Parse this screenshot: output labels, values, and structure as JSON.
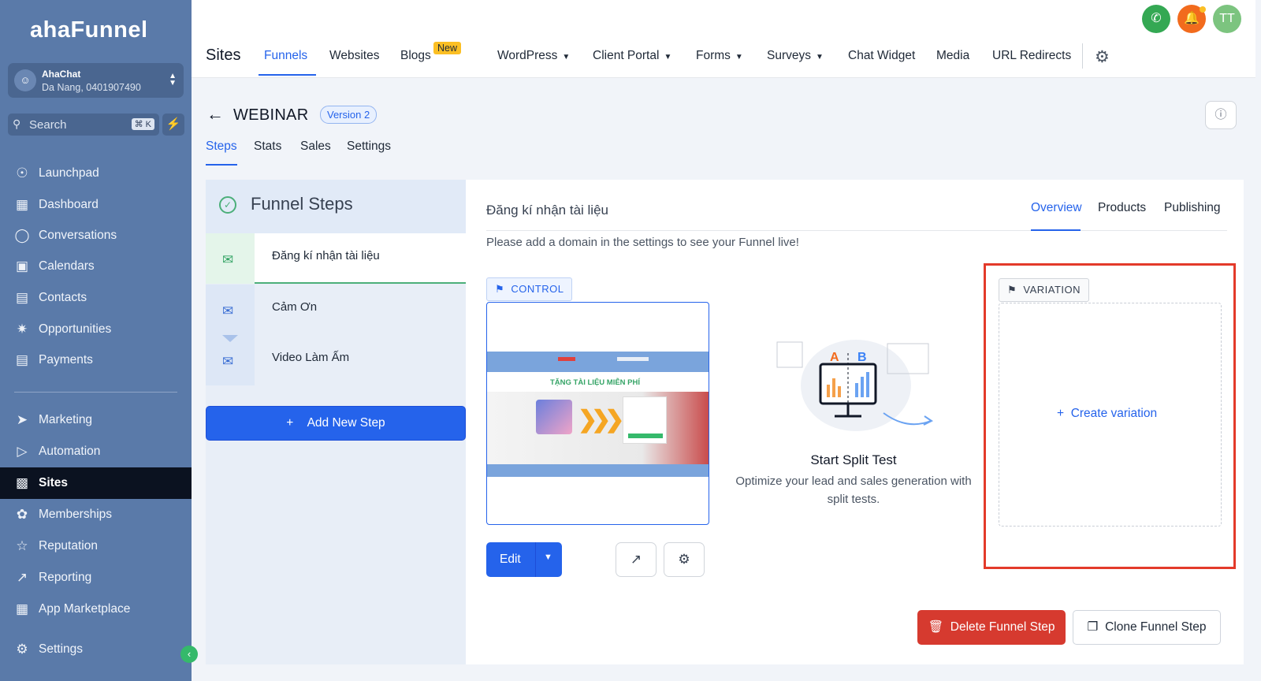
{
  "brand": {
    "logo_text": "ahaFunnel"
  },
  "account": {
    "name": "AhaChat",
    "sub": "Da Nang, 0401907490",
    "avatar_icon": "user-icon"
  },
  "search": {
    "placeholder": "Search",
    "shortcut": "⌘ K"
  },
  "sidebar": {
    "items": [
      {
        "label": "Launchpad",
        "icon": "launchpad-icon"
      },
      {
        "label": "Dashboard",
        "icon": "dashboard-icon"
      },
      {
        "label": "Conversations",
        "icon": "chat-icon"
      },
      {
        "label": "Calendars",
        "icon": "calendar-icon"
      },
      {
        "label": "Contacts",
        "icon": "contacts-icon"
      },
      {
        "label": "Opportunities",
        "icon": "opportunities-icon"
      },
      {
        "label": "Payments",
        "icon": "payments-icon"
      },
      {
        "label": "Marketing",
        "icon": "send-icon"
      },
      {
        "label": "Automation",
        "icon": "automation-icon"
      },
      {
        "label": "Sites",
        "icon": "sites-icon",
        "active": true
      },
      {
        "label": "Memberships",
        "icon": "award-icon"
      },
      {
        "label": "Reputation",
        "icon": "star-icon"
      },
      {
        "label": "Reporting",
        "icon": "trend-icon"
      },
      {
        "label": "App Marketplace",
        "icon": "grid-icon"
      },
      {
        "label": "Settings",
        "icon": "gear-icon"
      }
    ]
  },
  "topbar": {
    "title": "Sites",
    "tabs": [
      "Funnels",
      "Websites",
      "Blogs",
      "WordPress",
      "Client Portal",
      "Forms",
      "Surveys",
      "Chat Widget",
      "Media",
      "URL Redirects"
    ],
    "active_tab": "Funnels",
    "new_badge": "New",
    "avatar_initials": "TT"
  },
  "funnel": {
    "name": "WEBINAR",
    "version": "Version 2",
    "subtabs": [
      "Steps",
      "Stats",
      "Sales",
      "Settings"
    ],
    "active_subtab": "Steps"
  },
  "steps_panel": {
    "title": "Funnel Steps",
    "steps": [
      "Đăng kí nhận tài liệu",
      "Cảm Ơn",
      "Video Làm Ấm"
    ],
    "add_button": "Add New Step"
  },
  "main": {
    "step_title": "Đăng kí nhận tài liệu",
    "tabs": [
      "Overview",
      "Products",
      "Publishing"
    ],
    "active_tab": "Overview",
    "notice": "Please add a domain in the settings to see your Funnel live!",
    "control_label": "CONTROL",
    "preview_banner": "TẶNG TÀI LIỆU MIỄN PHÍ",
    "edit_label": "Edit",
    "split_title": "Start Split Test",
    "split_desc": "Optimize your lead and sales generation with split tests.",
    "variation_label": "VARIATION",
    "create_variation": "Create variation",
    "delete_label": "Delete Funnel Step",
    "clone_label": "Clone Funnel Step"
  },
  "colors": {
    "accent": "#2563eb",
    "sidebar": "#5a7aa9",
    "danger": "#d63a2f",
    "highlight": "#e33a2a"
  }
}
